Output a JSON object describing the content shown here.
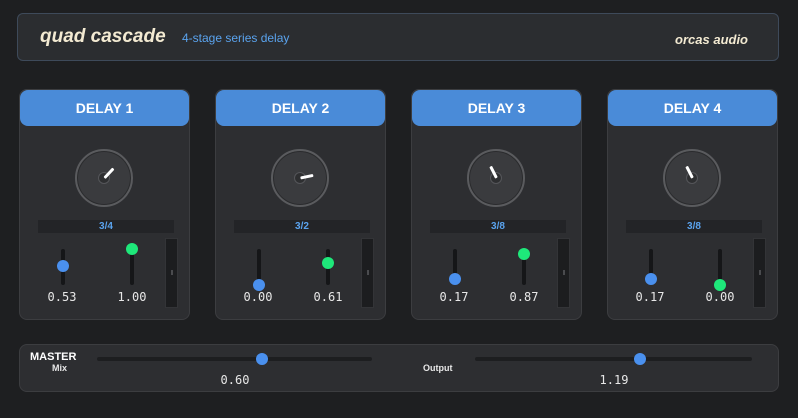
{
  "header": {
    "title": "quad cascade",
    "subtitle": "4-stage series delay",
    "brand": "orcas audio"
  },
  "colors": {
    "accent": "#4a8bd8",
    "slider_blue": "#4a90ee",
    "slider_green": "#1ee87a",
    "title_text": "#f3ead2"
  },
  "delays": [
    {
      "label": "DELAY 1",
      "ratio": "3/4",
      "time_knob": 0.66,
      "slider1": "0.53",
      "slider2": "1.00",
      "slider1_value": 0.53,
      "slider2_value": 1.0
    },
    {
      "label": "DELAY 2",
      "ratio": "3/2",
      "time_knob": 0.79,
      "slider1": "0.00",
      "slider2": "0.61",
      "slider1_value": 0.0,
      "slider2_value": 0.61
    },
    {
      "label": "DELAY 3",
      "ratio": "3/8",
      "time_knob": 0.4,
      "slider1": "0.17",
      "slider2": "0.87",
      "slider1_value": 0.17,
      "slider2_value": 0.87
    },
    {
      "label": "DELAY 4",
      "ratio": "3/8",
      "time_knob": 0.4,
      "slider1": "0.17",
      "slider2": "0.00",
      "slider1_value": 0.17,
      "slider2_value": 0.0
    }
  ],
  "master": {
    "label": "MASTER",
    "mix_label": "Mix",
    "mix_value": "0.60",
    "mix_level": 0.6,
    "output_label": "Output",
    "output_value": "1.19",
    "output_level": 0.595
  }
}
